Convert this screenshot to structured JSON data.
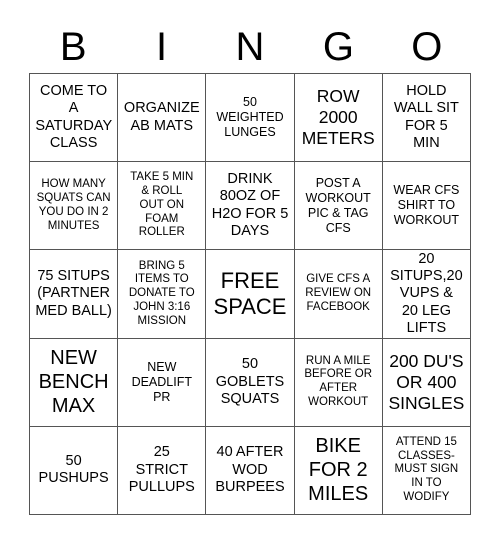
{
  "header": {
    "letters": [
      "B",
      "I",
      "N",
      "G",
      "O"
    ]
  },
  "grid": {
    "rows": [
      [
        "COME TO A SATURDAY CLASS",
        "ORGANIZE AB MATS",
        "50 WEIGHTED LUNGES",
        "ROW 2000 METERS",
        "HOLD WALL SIT FOR 5 MIN"
      ],
      [
        "HOW MANY SQUATS CAN YOU DO IN 2 MINUTES",
        "TAKE 5 MIN & ROLL OUT ON FOAM ROLLER",
        "DRINK 80OZ OF H2O FOR 5 DAYS",
        "POST A WORKOUT PIC & TAG CFS",
        "WEAR CFS SHIRT TO WORKOUT"
      ],
      [
        "75 SITUPS (PARTNER MED BALL)",
        "BRING 5 ITEMS TO DONATE TO JOHN 3:16 MISSION",
        "FREE SPACE",
        "GIVE CFS A REVIEW ON FACEBOOK",
        "20 SITUPS,20 VUPS & 20 LEG LIFTS"
      ],
      [
        "NEW BENCH MAX",
        "NEW DEADLIFT PR",
        "50 GOBLETS SQUATS",
        "RUN A MILE BEFORE OR AFTER WORKOUT",
        "200 DU'S OR 400 SINGLES"
      ],
      [
        "50 PUSHUPS",
        "25 STRICT PULLUPS",
        "40 AFTER WOD BURPEES",
        "BIKE FOR 2 MILES",
        "ATTEND 15 CLASSES-MUST SIGN IN TO WODIFY"
      ]
    ]
  }
}
